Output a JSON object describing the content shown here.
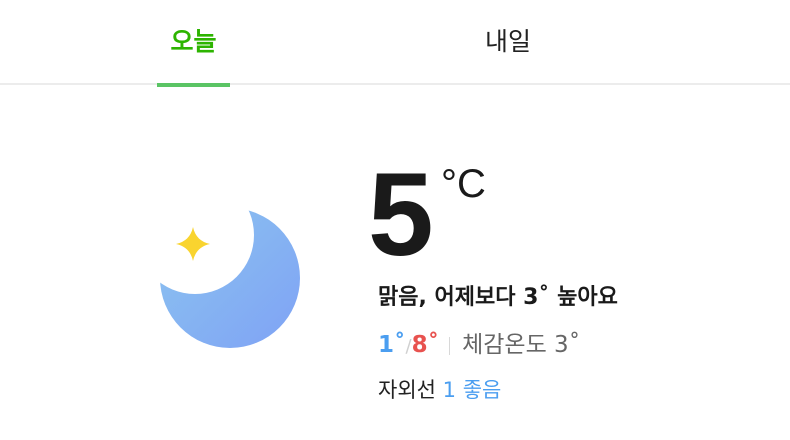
{
  "tabs": {
    "today": "오늘",
    "tomorrow": "내일"
  },
  "colors": {
    "active_tab": "#2db400",
    "tab_indicator": "#5ac464",
    "min_temp": "#4b9ef0",
    "max_temp": "#e8524f",
    "uv_level": "#4b9ef0",
    "moon_top": "#8cc5ef",
    "moon_bottom": "#7fa2f5",
    "star": "#f9d42f"
  },
  "weather": {
    "icon": "clear-night-moon-icon",
    "temperature": "5",
    "unit": "°C",
    "summary": "맑음, 어제보다 3˚ 높아요",
    "min_temp": "1˚",
    "max_temp": "8˚",
    "slash": "/",
    "feels_like": "체감온도 3˚",
    "uv_label": "자외선",
    "uv_value": "1 좋음"
  }
}
